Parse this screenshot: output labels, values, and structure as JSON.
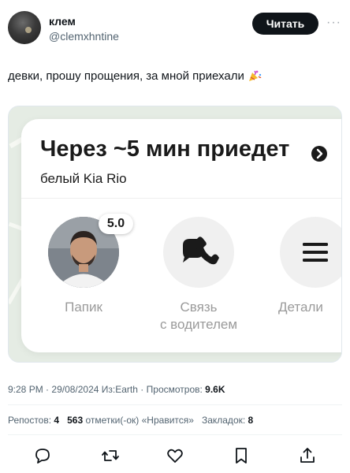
{
  "author": {
    "display_name": "клем",
    "handle": "@clemxhntine"
  },
  "follow_label": "Читать",
  "more_label": "···",
  "tweet": {
    "text": "девки, прошу прощения, за мной приехали",
    "emoji": "party-popper-icon"
  },
  "taxi": {
    "eta": "Через ~5 мин приедет",
    "car": "белый Kia Rio",
    "rating": "5.0",
    "actions": [
      {
        "label": "Папик"
      },
      {
        "label_line1": "Связь",
        "label_line2": "с водителем"
      },
      {
        "label": "Детали"
      }
    ]
  },
  "meta": {
    "time": "9:28 PM",
    "date": "29/08/2024",
    "source": "Из:Earth",
    "views_label": "Просмотров:",
    "views": "9.6K"
  },
  "stats": {
    "reposts_label": "Репостов:",
    "reposts": "4",
    "likes": "563",
    "likes_label": "отметки(-ок) «Нравится»",
    "bookmarks_label": "Закладок:",
    "bookmarks": "8"
  },
  "icons": [
    "reply-icon",
    "repost-icon",
    "like-icon",
    "bookmark-icon",
    "share-icon"
  ],
  "colors": {
    "primary_text": "#0f1419",
    "secondary_text": "#536471",
    "follow_button": "#0f1419",
    "map_background": "#e5ece4"
  }
}
